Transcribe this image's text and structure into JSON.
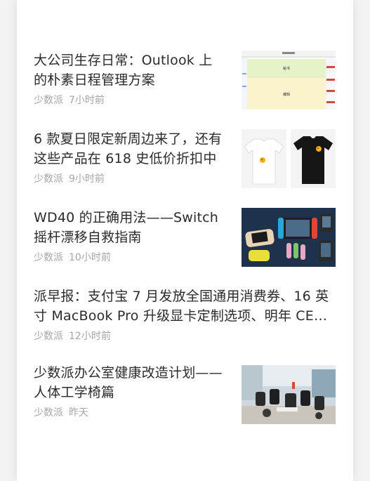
{
  "articles": [
    {
      "title": "大公司生存日常：Outlook 上的朴素日程管理方案",
      "source": "少数派",
      "time": "7小时前",
      "thumb_labels": [
        "秘书",
        "编辑"
      ]
    },
    {
      "title": "6 款夏日限定新周边来了，还有这些产品在 618 史低价折扣中",
      "source": "少数派",
      "time": "9小时前"
    },
    {
      "title": "WD40 的正确用法——Switch 摇杆漂移自救指南",
      "source": "少数派",
      "time": "10小时前"
    },
    {
      "title": "派早报：支付宝 7 月发放全国通用消费券、16 英寸 MacBook Pro 升级显卡定制选项、明年 CES …",
      "source": "少数派",
      "time": "12小时前"
    },
    {
      "title": "少数派办公室健康改造计划——人体工学椅篇",
      "source": "少数派",
      "time": "昨天"
    }
  ]
}
